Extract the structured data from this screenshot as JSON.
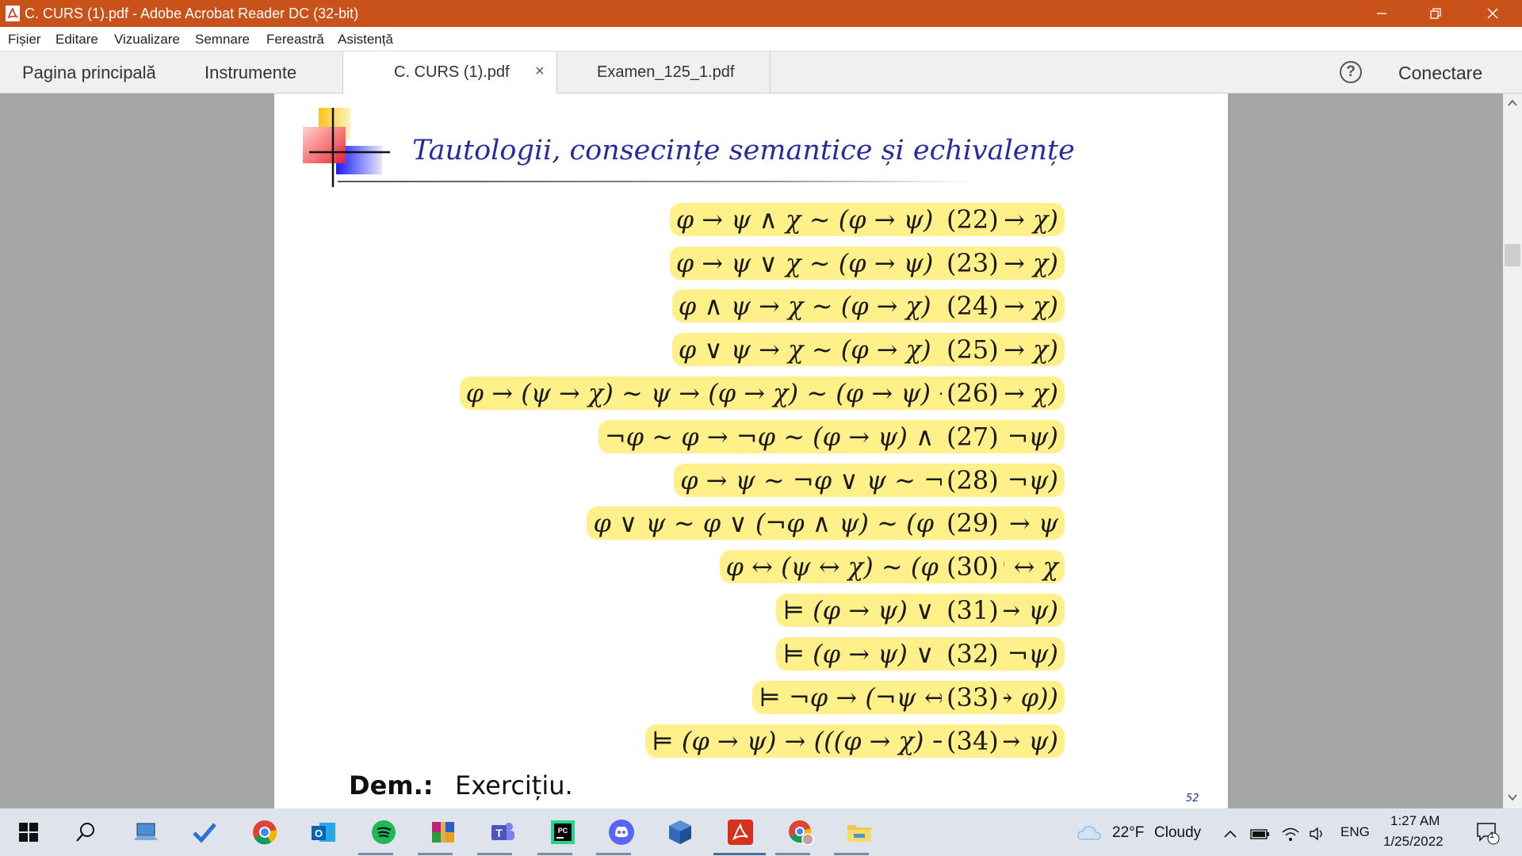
{
  "window": {
    "title": "C. CURS (1).pdf - Adobe Acrobat Reader DC (32-bit)",
    "minimize_icon": "minimize-icon",
    "restore_icon": "restore-icon",
    "close_icon": "close-icon"
  },
  "menu": [
    "Fișier",
    "Editare",
    "Vizualizare",
    "Semnare",
    "Fereastră",
    "Asistență"
  ],
  "tabs": {
    "home": "Pagina principală",
    "tools": "Instrumente",
    "documents": [
      {
        "label": "C. CURS (1).pdf",
        "close": "×",
        "active": true
      },
      {
        "label": "Examen_125_1.pdf",
        "active": false
      }
    ],
    "help": "?",
    "connect": "Conectare"
  },
  "page": {
    "title": "Tautologii, consecințe semantice și echivalențe",
    "formulas": [
      {
        "expr": "φ → ψ ∧ χ ∼ (φ → ψ) ∧ (φ → χ)",
        "num": "(22)"
      },
      {
        "expr": "φ → ψ ∨ χ ∼ (φ → ψ) ∨ (φ → χ)",
        "num": "(23)"
      },
      {
        "expr": "φ ∧ ψ → χ ∼ (φ → χ) ∨ (ψ → χ)",
        "num": "(24)"
      },
      {
        "expr": "φ ∨ ψ → χ ∼ (φ → χ) ∧ (ψ → χ)",
        "num": "(25)"
      },
      {
        "expr": "φ → (ψ → χ) ∼ ψ → (φ → χ) ∼ (φ → ψ) → (φ → χ)",
        "num": "(26)"
      },
      {
        "expr": "¬φ ∼ φ → ¬φ ∼ (φ → ψ) ∧ (φ → ¬ψ)",
        "num": "(27)"
      },
      {
        "expr": "φ → ψ ∼ ¬φ ∨ ψ ∼ ¬(φ ∧ ¬ψ)",
        "num": "(28)"
      },
      {
        "expr": "φ ∨ ψ ∼ φ ∨ (¬φ ∧ ψ) ∼ (φ → ψ) → ψ",
        "num": "(29)"
      },
      {
        "expr": "φ ↔ (ψ ↔ χ) ∼ (φ ↔ ψ) ↔ χ",
        "num": "(30)"
      },
      {
        "expr": "⊨ (φ → ψ) ∨ (¬φ → ψ)",
        "num": "(31)"
      },
      {
        "expr": "⊨ (φ → ψ) ∨ (φ → ¬ψ)",
        "num": "(32)"
      },
      {
        "expr": "⊨ ¬φ → (¬ψ ↔ (ψ → φ))",
        "num": "(33)"
      },
      {
        "expr": "⊨ (φ → ψ) → (((φ → χ) → ψ) → ψ)",
        "num": "(34)"
      }
    ],
    "dem_label": "Dem.:",
    "dem_text": "Exercițiu.",
    "page_number": "52"
  },
  "taskbar": {
    "apps": [
      "start-icon",
      "search-icon",
      "laptop-icon",
      "todo-icon",
      "chrome-icon",
      "outlook-icon",
      "spotify-icon",
      "winrar-icon",
      "teams-icon",
      "pycharm-icon",
      "discord-icon",
      "virtualbox-icon",
      "acrobat-icon",
      "chrome-profile-icon",
      "file-explorer-icon"
    ],
    "weather_temp": "22°F",
    "weather_text": "Cloudy",
    "language": "ENG",
    "time": "1:27 AM",
    "date": "1/25/2022",
    "notification_count": "1"
  },
  "colors": {
    "titlebar": "#c9521b",
    "highlight": "#fff08a",
    "slide_title": "#2a2aa0",
    "doc_background": "#a6a6a6"
  }
}
